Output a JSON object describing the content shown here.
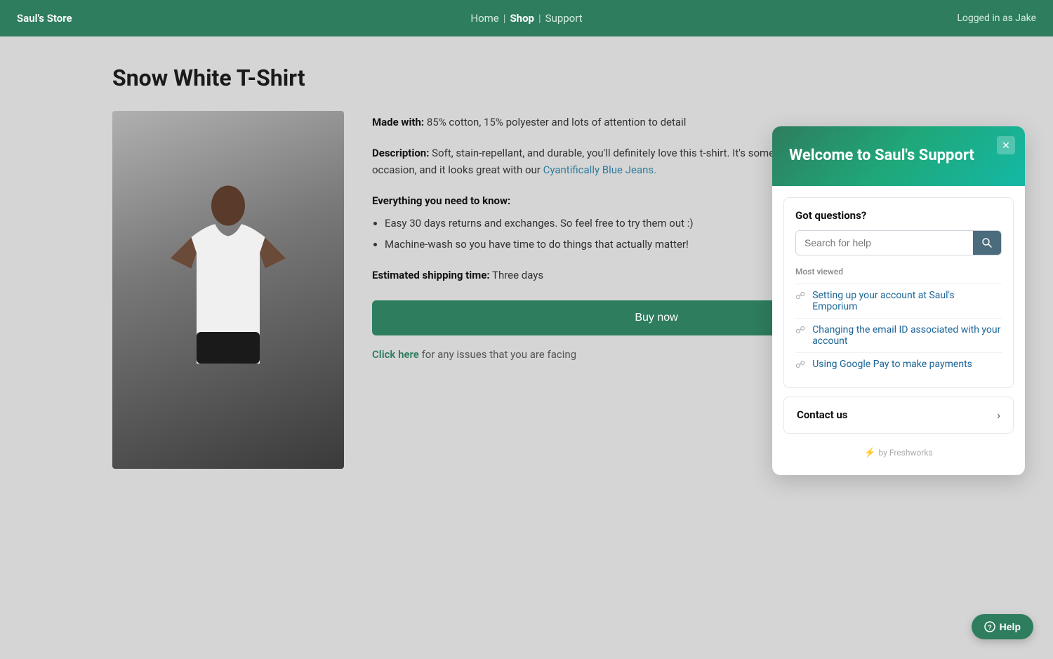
{
  "navbar": {
    "brand": "Saul's Store",
    "links": [
      {
        "label": "Home",
        "active": false
      },
      {
        "label": "Shop",
        "active": true
      },
      {
        "label": "Support",
        "active": false
      }
    ],
    "user": "Logged in as Jake"
  },
  "product": {
    "title": "Snow White T-Shirt",
    "made_with_label": "Made with:",
    "made_with_value": " 85% cotton, 15% polyester and lots of attention to detail",
    "description_label": "Description:",
    "description_value": " Soft, stain-repellant, and durable, you'll definitely love this t-shirt. It's something you can wear for any occasion, and it looks great with our ",
    "description_link_text": "Cyantifically Blue Jeans.",
    "everything_label": "Everything you need to know:",
    "bullets": [
      "Easy 30 days returns and exchanges. So feel free to try them out :)",
      "Machine-wash so you have time to do things that actually matter!"
    ],
    "shipping_label": "Estimated shipping time:",
    "shipping_value": " Three days",
    "buy_button": "Buy now",
    "issue_text": " for any issues that you are facing",
    "issue_link_text": "Click here"
  },
  "support_widget": {
    "title": "Welcome to Saul's Support",
    "close_icon": "✕",
    "got_questions": "Got questions?",
    "search_placeholder": "Search for help",
    "most_viewed_label": "Most viewed",
    "help_items": [
      {
        "text": "Setting up your account at Saul's Emporium"
      },
      {
        "text": "Changing the email ID associated with your account"
      },
      {
        "text": "Using Google Pay to make payments"
      }
    ],
    "contact_label": "Contact us",
    "powered_by": "by Freshworks"
  },
  "help_fab": {
    "label": "Help"
  }
}
